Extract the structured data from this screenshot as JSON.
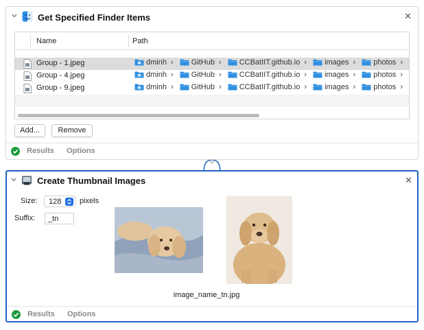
{
  "actions": [
    {
      "title": "Get Specified Finder Items",
      "table": {
        "headers": [
          "Name",
          "Path"
        ],
        "rows": [
          {
            "name": "Group - 1.jpeg",
            "path": [
              "dminh",
              "GitHub",
              "CCBatIIT.github.io",
              "images",
              "photos"
            ]
          },
          {
            "name": "Group - 4.jpeg",
            "path": [
              "dminh",
              "GitHub",
              "CCBatIIT.github.io",
              "images",
              "photos"
            ]
          },
          {
            "name": "Group - 9.jpeg",
            "path": [
              "dminh",
              "GitHub",
              "CCBatIIT.github.io",
              "images",
              "photos"
            ]
          }
        ]
      },
      "buttons": {
        "add": "Add...",
        "remove": "Remove"
      },
      "footer": {
        "results": "Results",
        "options": "Options"
      }
    },
    {
      "title": "Create Thumbnail Images",
      "size": {
        "label": "Size:",
        "value": "128",
        "unit": "pixels"
      },
      "suffix": {
        "label": "Suffix:",
        "value": "_tn"
      },
      "caption": "image_name_tn.jpg",
      "footer": {
        "results": "Results",
        "options": "Options"
      }
    }
  ],
  "icons": {
    "close": "close-icon",
    "collapse": "chevron-down-icon",
    "finder": "finder-icon",
    "thumbnail": "thumbnail-action-icon",
    "file": "jpeg-file-icon",
    "folder": "folder-icon",
    "status": "checkmark-circle-icon"
  },
  "colors": {
    "selection_border": "#1e62c3",
    "folder": "#2f8fe0",
    "status_ok": "#1d9a3b",
    "popup_accent": "#1f6fe6"
  }
}
